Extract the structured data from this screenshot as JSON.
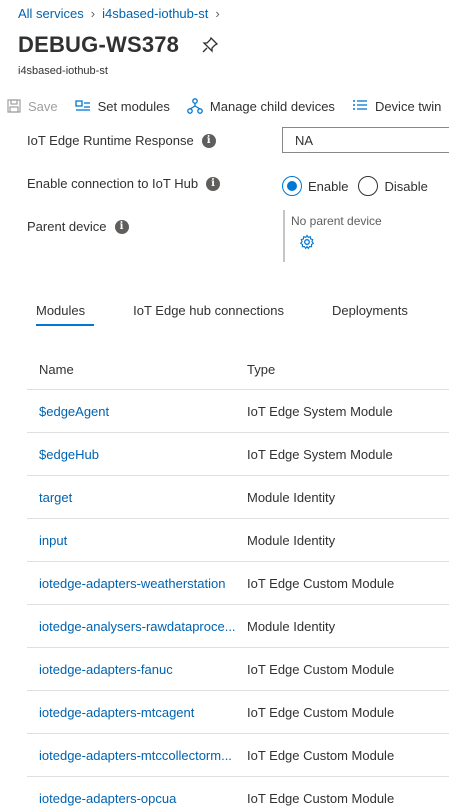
{
  "breadcrumb": {
    "items": [
      "All services",
      "i4sbased-iothub-st"
    ]
  },
  "header": {
    "title": "DEBUG-WS378",
    "subtitle": "i4sbased-iothub-st"
  },
  "toolbar": {
    "save_label": "Save",
    "set_modules_label": "Set modules",
    "manage_child_label": "Manage child devices",
    "device_twin_label": "Device twin"
  },
  "properties": {
    "runtime_label": "IoT Edge Runtime Response",
    "runtime_value": "NA",
    "connection_label": "Enable connection to IoT Hub",
    "enable_label": "Enable",
    "disable_label": "Disable",
    "connection_selected": "Enable",
    "parent_label": "Parent device",
    "parent_value": "No parent device"
  },
  "tabs": [
    "Modules",
    "IoT Edge hub connections",
    "Deployments"
  ],
  "table": {
    "headers": {
      "name": "Name",
      "type": "Type"
    },
    "rows": [
      {
        "name": "$edgeAgent",
        "type": "IoT Edge System Module"
      },
      {
        "name": "$edgeHub",
        "type": "IoT Edge System Module"
      },
      {
        "name": "target",
        "type": "Module Identity"
      },
      {
        "name": "input",
        "type": "Module Identity"
      },
      {
        "name": "iotedge-adapters-weatherstation",
        "type": "IoT Edge Custom Module"
      },
      {
        "name": "iotedge-analysers-rawdataproce...",
        "type": "Module Identity"
      },
      {
        "name": "iotedge-adapters-fanuc",
        "type": "IoT Edge Custom Module"
      },
      {
        "name": "iotedge-adapters-mtcagent",
        "type": "IoT Edge Custom Module"
      },
      {
        "name": "iotedge-adapters-mtccollectorm...",
        "type": "IoT Edge Custom Module"
      },
      {
        "name": "iotedge-adapters-opcua",
        "type": "IoT Edge Custom Module"
      }
    ]
  },
  "colors": {
    "link": "#0063b1",
    "accent": "#0078d4",
    "text": "#323130"
  }
}
